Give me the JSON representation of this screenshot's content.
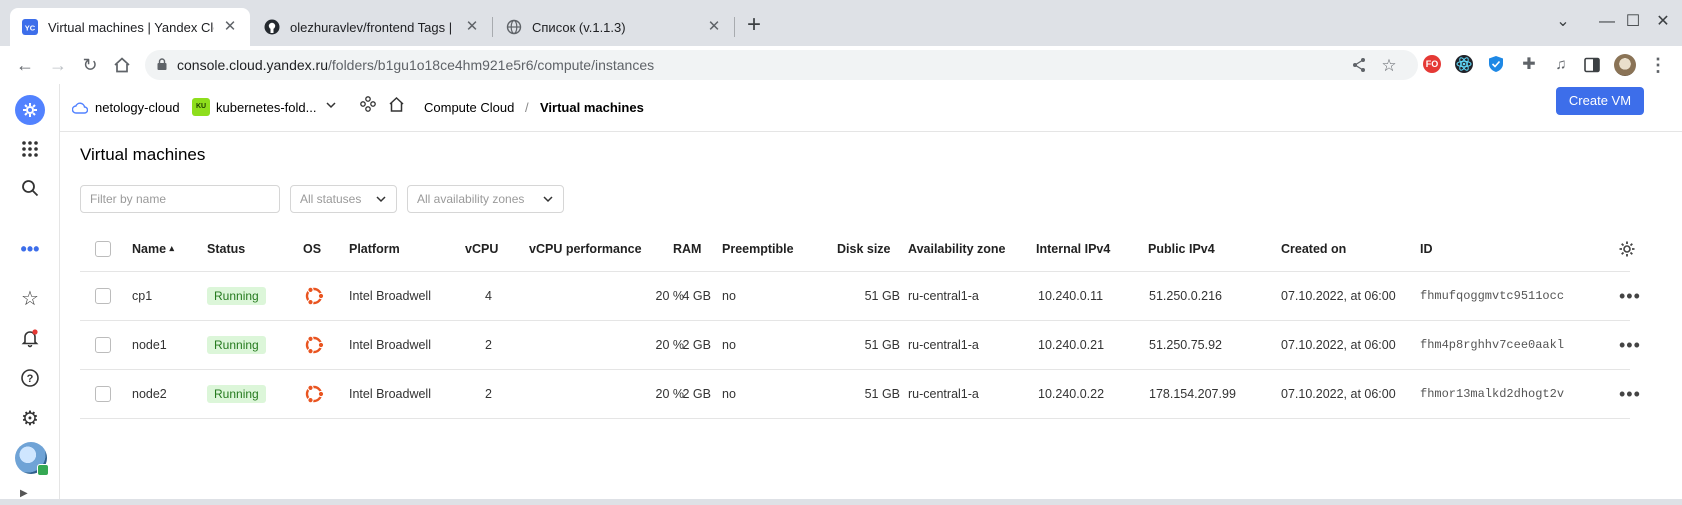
{
  "browser": {
    "tabs": [
      {
        "title": "Virtual machines | Yandex Cloud",
        "favicon": "yc-icon",
        "favicon_text": "YC"
      },
      {
        "title": "olezhuravlev/frontend Tags | Docker Hub",
        "favicon": "github-icon"
      },
      {
        "title": "Список (v.1.1.3)",
        "favicon": "globe-icon"
      }
    ],
    "new_tab": "+",
    "url_host": "console.cloud.yandex.ru",
    "url_path": "/folders/b1gu1o18ce4hm921e5r6/compute/instances",
    "extensions": [
      {
        "name": "fo-extension-icon",
        "text": "FO",
        "color": "#e53935"
      },
      {
        "name": "react-extension-icon",
        "text": "",
        "color": "#20232a"
      },
      {
        "name": "shield-extension-icon",
        "text": "",
        "color": "#1e88e5"
      }
    ]
  },
  "header": {
    "cloud": "netology-cloud",
    "folder_badge": "KU",
    "folder": "kubernetes-fold...",
    "breadcrumb_service": "Compute Cloud",
    "breadcrumb_sep": "/",
    "breadcrumb_page": "Virtual machines",
    "create_button": "Create VM"
  },
  "page": {
    "title": "Virtual machines",
    "filter_placeholder": "Filter by name",
    "status_select": "All statuses",
    "zone_select": "All availability zones"
  },
  "table": {
    "columns": {
      "name": "Name",
      "sort_indicator": "▴",
      "status": "Status",
      "os": "OS",
      "platform": "Platform",
      "vcpu": "vCPU",
      "vcpu_perf": "vCPU performance",
      "ram": "RAM",
      "preemptible": "Preemptible",
      "disk": "Disk size",
      "zone": "Availability zone",
      "internal_ip": "Internal IPv4",
      "public_ip": "Public IPv4",
      "created": "Created on",
      "id": "ID"
    },
    "rows": [
      {
        "name": "cp1",
        "status": "Running",
        "os": "ubuntu-icon",
        "platform": "Intel Broadwell",
        "vcpu": "4",
        "vcpu_perf": "20 %",
        "ram": "4 GB",
        "preemptible": "no",
        "disk": "51 GB",
        "zone": "ru-central1-a",
        "internal_ip": "10.240.0.11",
        "public_ip": "51.250.0.216",
        "created": "07.10.2022, at 06:00",
        "id": "fhmufqoggmvtc9511occ"
      },
      {
        "name": "node1",
        "status": "Running",
        "os": "ubuntu-icon",
        "platform": "Intel Broadwell",
        "vcpu": "2",
        "vcpu_perf": "20 %",
        "ram": "2 GB",
        "preemptible": "no",
        "disk": "51 GB",
        "zone": "ru-central1-a",
        "internal_ip": "10.240.0.21",
        "public_ip": "51.250.75.92",
        "created": "07.10.2022, at 06:00",
        "id": "fhm4p8rghhv7cee0aakl"
      },
      {
        "name": "node2",
        "status": "Running",
        "os": "ubuntu-icon",
        "platform": "Intel Broadwell",
        "vcpu": "2",
        "vcpu_perf": "20 %",
        "ram": "2 GB",
        "preemptible": "no",
        "disk": "51 GB",
        "zone": "ru-central1-a",
        "internal_ip": "10.240.0.22",
        "public_ip": "178.154.207.99",
        "created": "07.10.2022, at 06:00",
        "id": "fhmor13malkd2dhogt2v"
      }
    ]
  },
  "colors": {
    "accent": "#3d6eea",
    "running_bg": "#dcf6d9",
    "running_text": "#257a1e",
    "ubuntu": "#e95420"
  }
}
